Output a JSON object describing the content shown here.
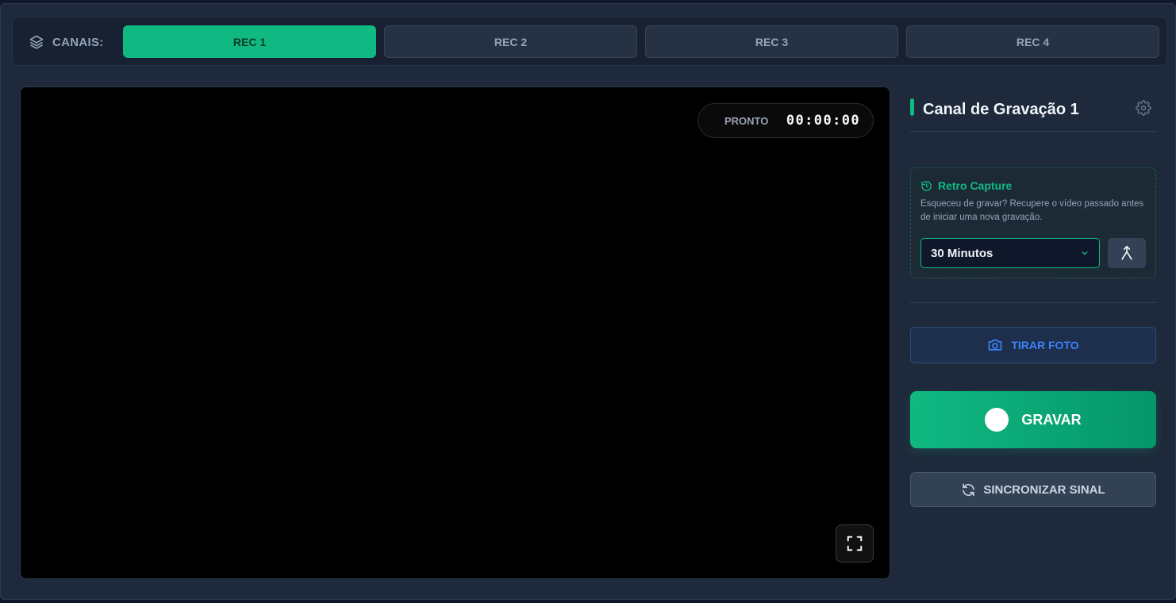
{
  "channels": {
    "label": "CANAIS:",
    "icon": "layers-icon",
    "tabs": [
      {
        "label": "REC 1",
        "active": true
      },
      {
        "label": "REC 2",
        "active": false
      },
      {
        "label": "REC 3",
        "active": false
      },
      {
        "label": "REC 4",
        "active": false
      }
    ]
  },
  "video": {
    "status": "PRONTO",
    "timer": "00:00:00",
    "fullscreen_icon": "fullscreen-icon"
  },
  "panel": {
    "title": "Canal de Gravação 1",
    "settings_icon": "gear-icon",
    "retro": {
      "title": "Retro Capture",
      "icon": "history-icon",
      "description": "Esqueceu de gravar? Recupere o vídeo passado antes de iniciar uma nova gravação.",
      "selected_duration": "30 Minutos",
      "merge_icon": "merge-icon"
    },
    "photo_button": "TIRAR FOTO",
    "record_button": "GRAVAR",
    "sync_button": "SINCRONIZAR SINAL"
  },
  "colors": {
    "accent": "#10b981",
    "background": "#1e293b",
    "photo_blue": "#3b82f6"
  }
}
